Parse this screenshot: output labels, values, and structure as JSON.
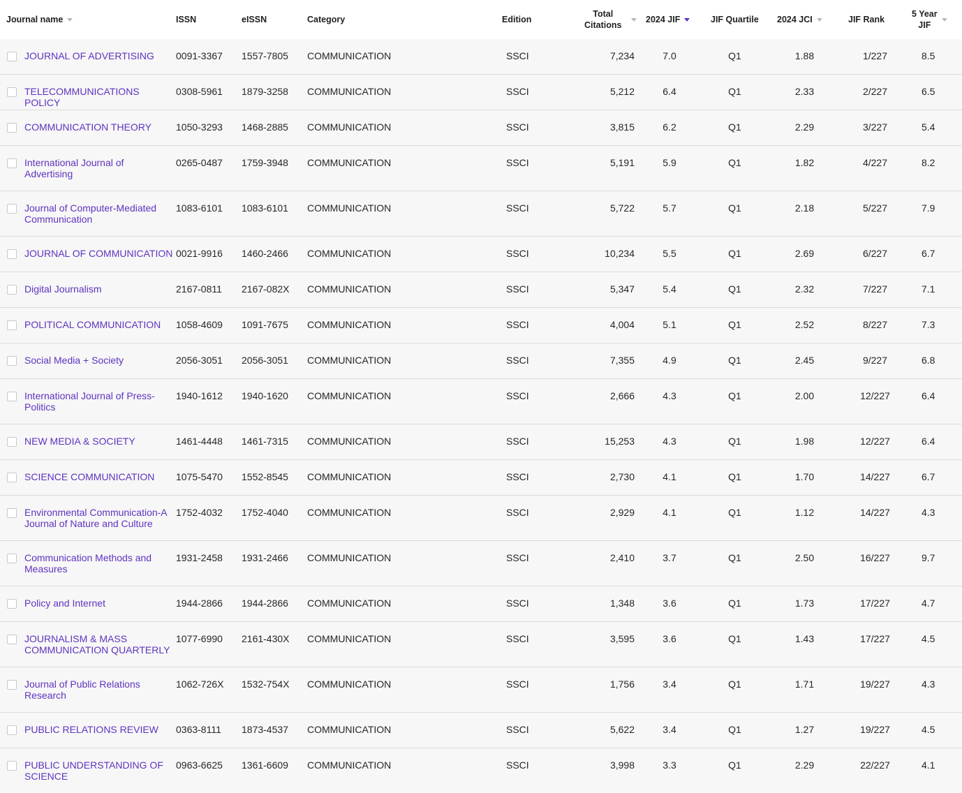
{
  "columns": {
    "journal_name": "Journal name",
    "issn": "ISSN",
    "eissn": "eISSN",
    "category": "Category",
    "edition": "Edition",
    "total_citations_line1": "Total",
    "total_citations_line2": "Citations",
    "jif_2024": "2024 JIF",
    "jif_quartile": "JIF Quartile",
    "jci_2024": "2024 JCI",
    "jif_rank": "JIF Rank",
    "five_year_jif_line1": "5 Year",
    "five_year_jif_line2": "JIF"
  },
  "sort": {
    "active_column": "2024 JIF",
    "direction": "descending",
    "active_color": "#5e33bf",
    "inactive_color": "#b8b8b8"
  },
  "colors": {
    "link": "#5e33bf",
    "row_background": "#f7f7f7",
    "row_divider": "#dcdcdc",
    "header_background": "#ffffff"
  },
  "rows": [
    {
      "name": "JOURNAL OF ADVERTISING",
      "issn": "0091-3367",
      "eissn": "1557-7805",
      "category": "COMMUNICATION",
      "edition": "SSCI",
      "citations": "7,234",
      "jif": "7.0",
      "quartile": "Q1",
      "jci": "1.88",
      "rank": "1/227",
      "jif5": "8.5"
    },
    {
      "name": "TELECOMMUNICATIONS POLICY",
      "issn": "0308-5961",
      "eissn": "1879-3258",
      "category": "COMMUNICATION",
      "edition": "SSCI",
      "citations": "5,212",
      "jif": "6.4",
      "quartile": "Q1",
      "jci": "2.33",
      "rank": "2/227",
      "jif5": "6.5"
    },
    {
      "name": "COMMUNICATION THEORY",
      "issn": "1050-3293",
      "eissn": "1468-2885",
      "category": "COMMUNICATION",
      "edition": "SSCI",
      "citations": "3,815",
      "jif": "6.2",
      "quartile": "Q1",
      "jci": "2.29",
      "rank": "3/227",
      "jif5": "5.4"
    },
    {
      "name": "International Journal of Advertising",
      "issn": "0265-0487",
      "eissn": "1759-3948",
      "category": "COMMUNICATION",
      "edition": "SSCI",
      "citations": "5,191",
      "jif": "5.9",
      "quartile": "Q1",
      "jci": "1.82",
      "rank": "4/227",
      "jif5": "8.2"
    },
    {
      "name": "Journal of Computer-Mediated Communication",
      "issn": "1083-6101",
      "eissn": "1083-6101",
      "category": "COMMUNICATION",
      "edition": "SSCI",
      "citations": "5,722",
      "jif": "5.7",
      "quartile": "Q1",
      "jci": "2.18",
      "rank": "5/227",
      "jif5": "7.9"
    },
    {
      "name": "JOURNAL OF COMMUNICATION",
      "issn": "0021-9916",
      "eissn": "1460-2466",
      "category": "COMMUNICATION",
      "edition": "SSCI",
      "citations": "10,234",
      "jif": "5.5",
      "quartile": "Q1",
      "jci": "2.69",
      "rank": "6/227",
      "jif5": "6.7"
    },
    {
      "name": "Digital Journalism",
      "issn": "2167-0811",
      "eissn": "2167-082X",
      "category": "COMMUNICATION",
      "edition": "SSCI",
      "citations": "5,347",
      "jif": "5.4",
      "quartile": "Q1",
      "jci": "2.32",
      "rank": "7/227",
      "jif5": "7.1"
    },
    {
      "name": "POLITICAL COMMUNICATION",
      "issn": "1058-4609",
      "eissn": "1091-7675",
      "category": "COMMUNICATION",
      "edition": "SSCI",
      "citations": "4,004",
      "jif": "5.1",
      "quartile": "Q1",
      "jci": "2.52",
      "rank": "8/227",
      "jif5": "7.3"
    },
    {
      "name": "Social Media + Society",
      "issn": "2056-3051",
      "eissn": "2056-3051",
      "category": "COMMUNICATION",
      "edition": "SSCI",
      "citations": "7,355",
      "jif": "4.9",
      "quartile": "Q1",
      "jci": "2.45",
      "rank": "9/227",
      "jif5": "6.8"
    },
    {
      "name": "International Journal of Press-Politics",
      "issn": "1940-1612",
      "eissn": "1940-1620",
      "category": "COMMUNICATION",
      "edition": "SSCI",
      "citations": "2,666",
      "jif": "4.3",
      "quartile": "Q1",
      "jci": "2.00",
      "rank": "12/227",
      "jif5": "6.4"
    },
    {
      "name": "NEW MEDIA & SOCIETY",
      "issn": "1461-4448",
      "eissn": "1461-7315",
      "category": "COMMUNICATION",
      "edition": "SSCI",
      "citations": "15,253",
      "jif": "4.3",
      "quartile": "Q1",
      "jci": "1.98",
      "rank": "12/227",
      "jif5": "6.4"
    },
    {
      "name": "SCIENCE COMMUNICATION",
      "issn": "1075-5470",
      "eissn": "1552-8545",
      "category": "COMMUNICATION",
      "edition": "SSCI",
      "citations": "2,730",
      "jif": "4.1",
      "quartile": "Q1",
      "jci": "1.70",
      "rank": "14/227",
      "jif5": "6.7"
    },
    {
      "name": "Environmental Communication-A Journal of Nature and Culture",
      "issn": "1752-4032",
      "eissn": "1752-4040",
      "category": "COMMUNICATION",
      "edition": "SSCI",
      "citations": "2,929",
      "jif": "4.1",
      "quartile": "Q1",
      "jci": "1.12",
      "rank": "14/227",
      "jif5": "4.3"
    },
    {
      "name": "Communication Methods and Measures",
      "issn": "1931-2458",
      "eissn": "1931-2466",
      "category": "COMMUNICATION",
      "edition": "SSCI",
      "citations": "2,410",
      "jif": "3.7",
      "quartile": "Q1",
      "jci": "2.50",
      "rank": "16/227",
      "jif5": "9.7"
    },
    {
      "name": "Policy and Internet",
      "issn": "1944-2866",
      "eissn": "1944-2866",
      "category": "COMMUNICATION",
      "edition": "SSCI",
      "citations": "1,348",
      "jif": "3.6",
      "quartile": "Q1",
      "jci": "1.73",
      "rank": "17/227",
      "jif5": "4.7"
    },
    {
      "name": "JOURNALISM & MASS COMMUNICATION QUARTERLY",
      "issn": "1077-6990",
      "eissn": "2161-430X",
      "category": "COMMUNICATION",
      "edition": "SSCI",
      "citations": "3,595",
      "jif": "3.6",
      "quartile": "Q1",
      "jci": "1.43",
      "rank": "17/227",
      "jif5": "4.5"
    },
    {
      "name": "Journal of Public Relations Research",
      "issn": "1062-726X",
      "eissn": "1532-754X",
      "category": "COMMUNICATION",
      "edition": "SSCI",
      "citations": "1,756",
      "jif": "3.4",
      "quartile": "Q1",
      "jci": "1.71",
      "rank": "19/227",
      "jif5": "4.3"
    },
    {
      "name": "PUBLIC RELATIONS REVIEW",
      "issn": "0363-8111",
      "eissn": "1873-4537",
      "category": "COMMUNICATION",
      "edition": "SSCI",
      "citations": "5,622",
      "jif": "3.4",
      "quartile": "Q1",
      "jci": "1.27",
      "rank": "19/227",
      "jif5": "4.5"
    },
    {
      "name": "PUBLIC UNDERSTANDING OF SCIENCE",
      "issn": "0963-6625",
      "eissn": "1361-6609",
      "category": "COMMUNICATION",
      "edition": "SSCI",
      "citations": "3,998",
      "jif": "3.3",
      "quartile": "Q1",
      "jci": "2.29",
      "rank": "22/227",
      "jif5": "4.1"
    }
  ]
}
